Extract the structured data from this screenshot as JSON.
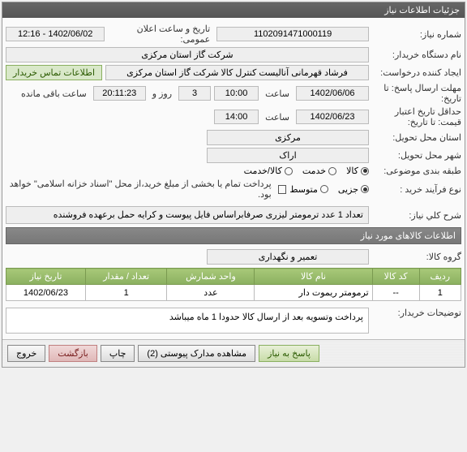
{
  "panel_title": "جزئیات اطلاعات نیاز",
  "labels": {
    "need_no": "شماره نياز:",
    "announce_dt": "تاریخ و ساعت اعلان عمومی:",
    "buyer_org": "نام دستگاه خريدار:",
    "requester": "ایجاد کننده درخواست:",
    "contact": "اطلاعات تماس خریدار",
    "answer_deadline": "مهلت ارسال پاسخ:",
    "day_and": "روز و",
    "remaining": "ساعت باقی مانده",
    "saat": "ساعت",
    "ta_tarikh": "تا تاریخ:",
    "valid_from": "حداقل تاریخ اعتبار",
    "price_to": "قیمت: تا تاریخ:",
    "state": "استان محل تحویل:",
    "city": "شهر محل تحویل:",
    "category": "طبقه بندی موضوعی:",
    "purchase_type": "نوع فرآیند خرید :",
    "pay_note": "پرداخت تمام یا بخشی از مبلغ خرید،از محل \"اسناد خزانه اسلامی\" خواهد بود.",
    "need_desc": "شرح كلي نياز:",
    "section_items": "اطلاعات کالاهای مورد نیاز",
    "goods_group": "گروه کالا:",
    "buyer_note": "توضیحات خریدار:"
  },
  "values": {
    "need_no": "1102091471000119",
    "announce_dt": "1402/06/02 - 12:16",
    "buyer_org": "شرکت گاز استان مرکزی",
    "requester": "فرشاد قهرمانی آنالیست کنترل کالا شرکت گاز استان مرکزی",
    "deadline_date": "1402/06/06",
    "deadline_time": "10:00",
    "days_left": "3",
    "time_left": "20:11:23",
    "valid_date": "1402/06/23",
    "valid_time": "14:00",
    "state": "مرکزی",
    "city": "اراک",
    "cat_goods": "کالا",
    "cat_service": "خدمت",
    "cat_goods_service": "کالا/خدمت",
    "pt_partial": "جزیی",
    "pt_medium": "متوسط",
    "desc": "تعداد 1 عدد ترمومتر لیزری صرفابراساس فایل پیوست و کرایه حمل برعهده فروشنده",
    "goods_group": "تعمیر و نگهداری",
    "buyer_note_text": "پرداخت وتسویه بعد از ارسال کالا حدودا 1 ماه میباشد"
  },
  "table": {
    "headers": [
      "ردیف",
      "کد کالا",
      "نام کالا",
      "واحد شمارش",
      "تعداد / مقدار",
      "تاریخ نیاز"
    ],
    "rows": [
      {
        "idx": "1",
        "code": "--",
        "name": "ترمومتر ریموت دار",
        "unit": "عدد",
        "qty": "1",
        "date": "1402/06/23"
      }
    ]
  },
  "buttons": {
    "respond": "پاسخ به نیاز",
    "view_docs": "مشاهده مدارک پیوستی (2)",
    "print": "چاپ",
    "back": "بازگشت",
    "exit": "خروج"
  }
}
